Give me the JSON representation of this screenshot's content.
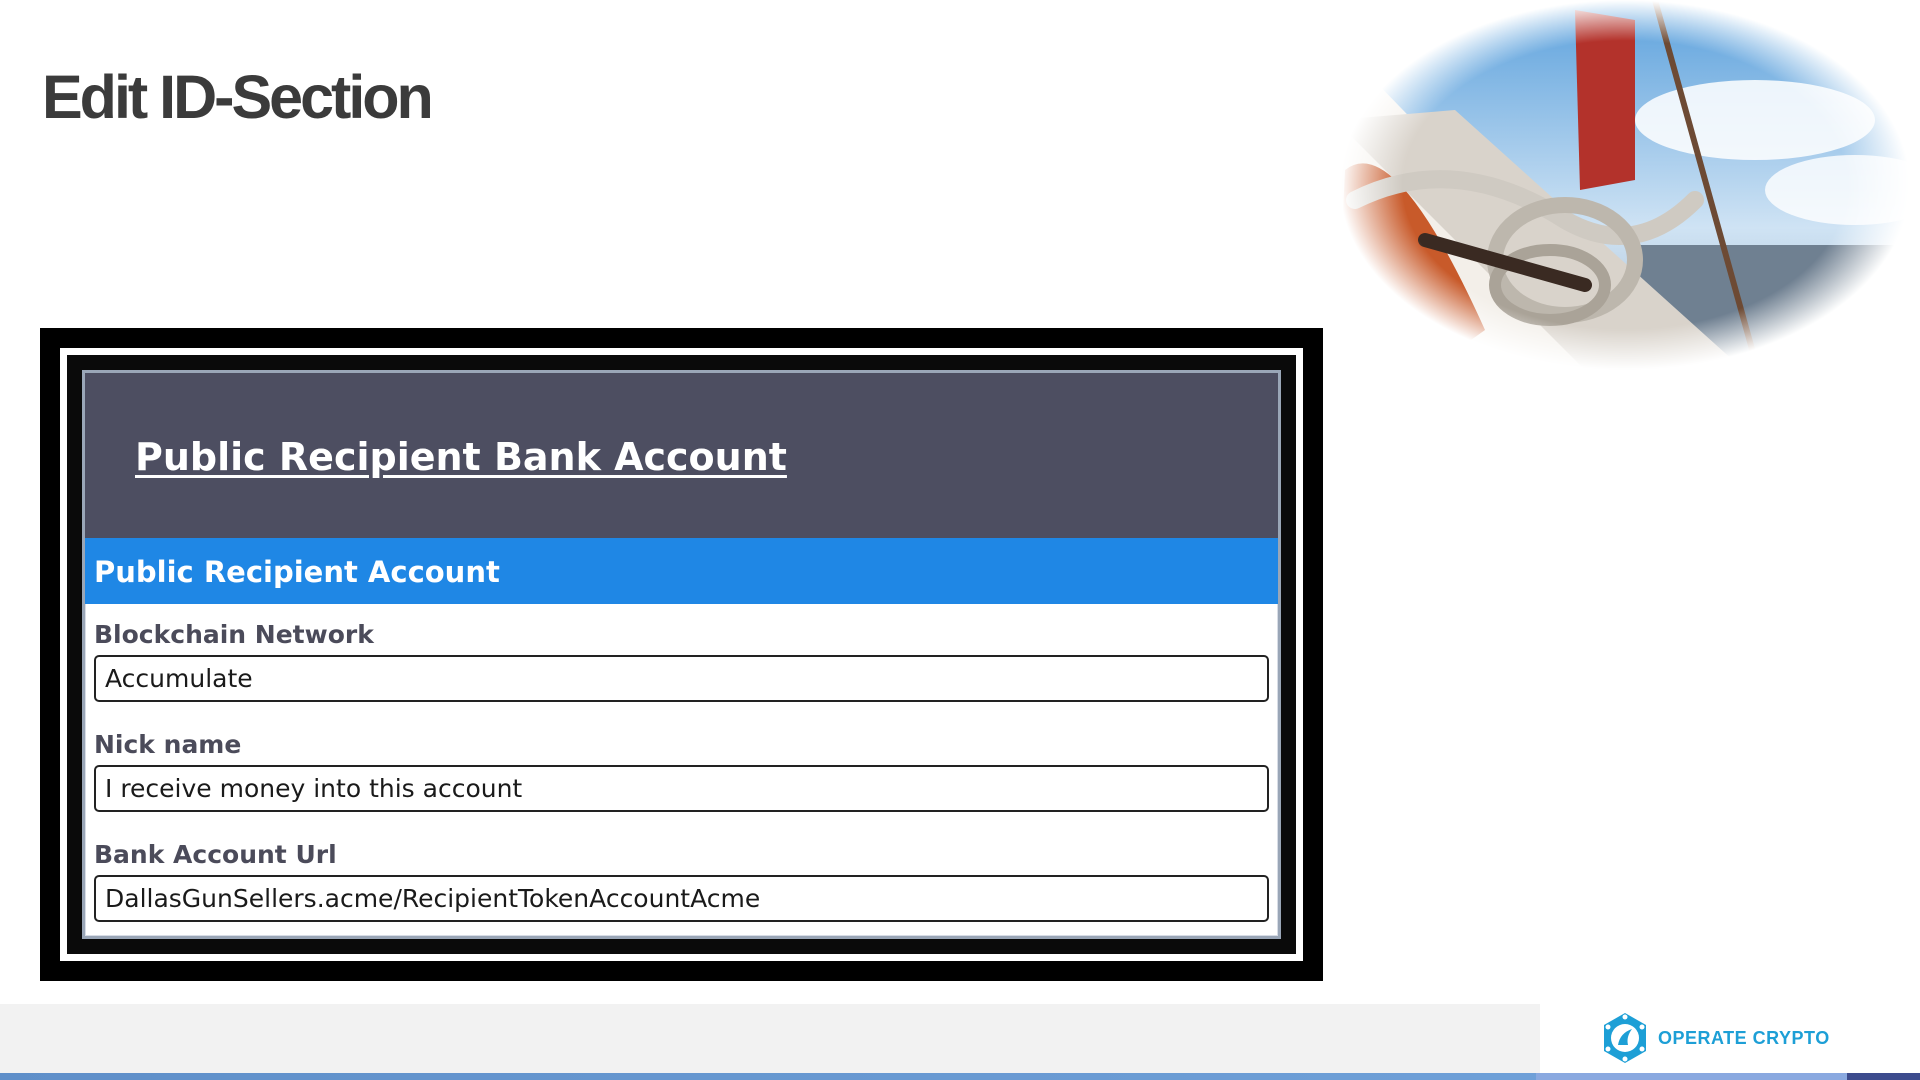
{
  "slide": {
    "title": "Edit ID-Section"
  },
  "panel": {
    "header_title": "Public Recipient Bank Account",
    "section_title": "Public Recipient Account",
    "fields": [
      {
        "label": "Blockchain Network",
        "value": "Accumulate"
      },
      {
        "label": "Nick name",
        "value": "I receive money into this account"
      },
      {
        "label": "Bank Account Url",
        "value": "DallasGunSellers.acme/RecipientTokenAccountAcme"
      }
    ]
  },
  "footer": {
    "brand": "OPERATE CRYPTO"
  },
  "colors": {
    "header_bg": "#4d4e61",
    "section_bar": "#1f87e5",
    "brand": "#1d9fd6"
  },
  "icons": [
    "photo-sailboat-rope",
    "operate-crypto-logo-icon"
  ]
}
